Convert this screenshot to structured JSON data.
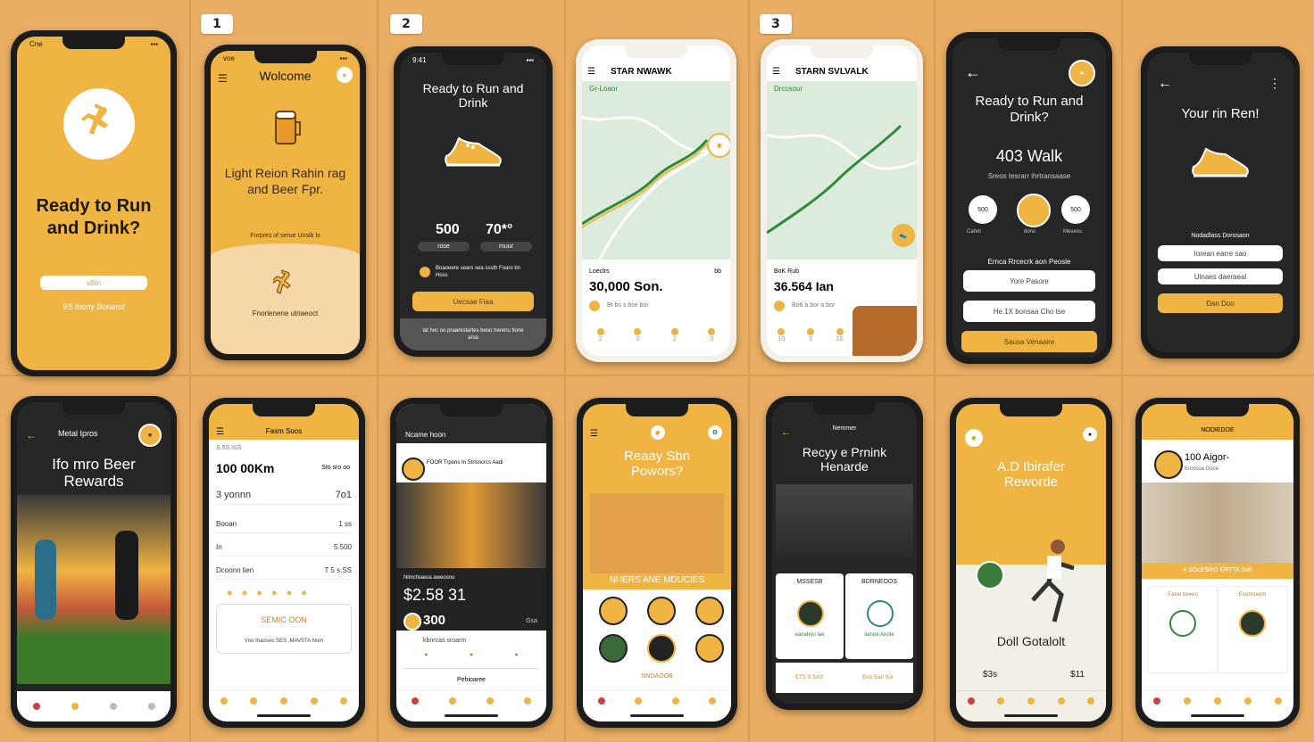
{
  "steps": [
    "1",
    "2",
    "3"
  ],
  "colors": {
    "background": "#E9AE63",
    "accent": "#F0B442",
    "dark": "#262626"
  },
  "s1": {
    "status": "Cne",
    "title": "Ready to Run and Drink?",
    "button": "sBIn",
    "link": "9S foony Bonend"
  },
  "s2": {
    "status": "voe",
    "welcome": "Wolcome",
    "headline": "Light Reion Rahin rag and Beer Fpr.",
    "sub": "Fnrpres of serue Unsib Is",
    "caption": "Fnorlenene utriaeoct"
  },
  "s3": {
    "title": "Ready to Run and Drink",
    "stat1": "500",
    "stat1_label": "rose",
    "stat2": "70*°",
    "stat2_label": "muur",
    "note": "Boaoeere sears sea sssth Foaro bn Hoss",
    "button": "Uecsae Fiaa",
    "footer": "lat hoc oo praarestartes beoo herenu tlone arsa"
  },
  "s4": {
    "header": "STAR NWAWK",
    "loc": "Gr-Loaor",
    "label": "Loeclrs",
    "label_right": "bb",
    "distance": "30,000 Son.",
    "sub": "Bt bs s bse bor",
    "tabs": [
      "2",
      "3",
      "2",
      "3"
    ]
  },
  "s5": {
    "header": "STARN SVLVALK",
    "loc": "Drccsour",
    "label": "BoK Rub",
    "distance": "36.564 Ian",
    "sub": "Bo6 a bor a bor",
    "tabs": [
      "10",
      "3",
      "10"
    ]
  },
  "s6": {
    "title": "Ready to Run and Drink?",
    "walk": "403 Walk",
    "sub": "Sreos tesrarr ihrtransaase",
    "b1": "500",
    "b2": "",
    "b3": "500",
    "b1_label": "Cahrir",
    "b2_label": "dons",
    "b3_label": "Mesens",
    "section": "Ernca Rrcecrk aon Peosie",
    "btn1": "Yore Pasore",
    "btn2": "He.1X bonsaa Cho tse",
    "btn3": "Sausa Venaaire"
  },
  "s7": {
    "title": "Your rin Ren!",
    "section": "Nodadlass Dorosaon",
    "f1": "Iorean earre sao",
    "f2": "Ulnaes daeraeal",
    "button": "Dan Doo"
  },
  "r1": {
    "header": "Metal Ipros",
    "title": "Ifo mro Beer Rewards"
  },
  "r2": {
    "header": "Fasm Soos",
    "label": "S.5S.ISS",
    "main": "100 00Km",
    "main_right": "Sto sro oo",
    "r1": "3 yonnn",
    "r1r": "7o1",
    "r2": "Booan",
    "r2r": "1 ss",
    "r3": "In",
    "r3r": "5.500",
    "r4": "Dcoonn lien",
    "r4r": "T 5 s.SS",
    "card": "SEMIC OON",
    "card_sub": "Vno Ihaoseo SES ,MAVSTA Nom"
  },
  "r3": {
    "header": "Ncame hoon",
    "card_title": "FOOR Trpons In Strlsncrcs Aadi",
    "price_label": "Nlmchiaeoa aweosno",
    "price": "$2.58 31",
    "price2": "300",
    "price2_right": "Gsa",
    "sub": "kbnrcas sroarm",
    "list": "Pehioaree"
  },
  "r4": {
    "title": "Reaay Sbn Powors?",
    "section": "NHERS ANE MDUCIES",
    "footer": "NNDAOOB"
  },
  "r5": {
    "header": "Nemmer",
    "title": "Recyy e Prnink Henarde",
    "col1": "MSSESB",
    "col2": "BDRNEOOS",
    "col1_sub": "eanahoo lae",
    "col2_sub": "lamoe Anote",
    "r1": "ETS S.SAS",
    "r2": "Eror Ean Sor"
  },
  "r6": {
    "title": "A.D Ibirafer Reworde",
    "caption": "Doll Gotalolt",
    "v1": "$3s",
    "v2": "$11"
  },
  "r7": {
    "header": "NODIEDOE",
    "title": "100 Aigor-",
    "sub": "Eomcoa Ooce",
    "strip": "4 SOcESRO ERTTA Sa6",
    "b1": "Ealoe beeeo",
    "b2": "Eoobrseem"
  }
}
